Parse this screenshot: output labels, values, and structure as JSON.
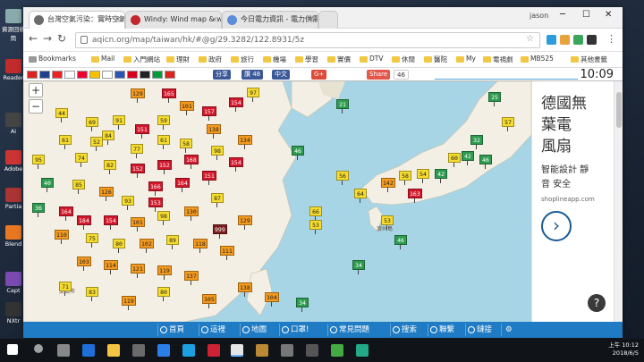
{
  "browser": {
    "tabs": [
      {
        "title": "台灣空氣污染：實時空氣",
        "favicon_color": "#6b6b6b"
      },
      {
        "title": "Windy: Wind map & we",
        "favicon_color": "#c4262e"
      },
      {
        "title": "今日電力資訊 - 電力供需",
        "favicon_color": "#5b8dd9"
      }
    ],
    "user": "jason",
    "address": "aqicn.org/map/taiwan/hk/#@g/29.3282/122.8931/5z",
    "bookmarks": [
      "Bookmarks",
      "Mail",
      "入門網站",
      "理財",
      "政府",
      "旅行",
      "機場",
      "學習",
      "實價",
      "DTV",
      "休閒",
      "醫院",
      "My",
      "電視劇",
      "MB525"
    ],
    "other_bookmarks": "其他書籤"
  },
  "page": {
    "share_label": "分享",
    "like_label": "讚 48",
    "zh_label": "中文",
    "gplus": "G+",
    "share_count_label": "Share",
    "share_count": "46",
    "clock": "10:09",
    "zoom_in": "+",
    "zoom_out": "−"
  },
  "map_markers": [
    {
      "v": "44",
      "c": "y"
    },
    {
      "v": "69",
      "c": "y"
    },
    {
      "v": "61",
      "c": "y"
    },
    {
      "v": "52",
      "c": "y"
    },
    {
      "v": "97",
      "c": "y"
    },
    {
      "v": "95",
      "c": "y"
    },
    {
      "v": "74",
      "c": "y"
    },
    {
      "v": "129",
      "c": "o"
    },
    {
      "v": "165",
      "c": "r"
    },
    {
      "v": "101",
      "c": "o"
    },
    {
      "v": "91",
      "c": "y"
    },
    {
      "v": "151",
      "c": "r"
    },
    {
      "v": "59",
      "c": "y"
    },
    {
      "v": "84",
      "c": "y"
    },
    {
      "v": "157",
      "c": "r"
    },
    {
      "v": "154",
      "c": "r"
    },
    {
      "v": "138",
      "c": "o"
    },
    {
      "v": "77",
      "c": "y"
    },
    {
      "v": "61",
      "c": "y"
    },
    {
      "v": "58",
      "c": "y"
    },
    {
      "v": "82",
      "c": "y"
    },
    {
      "v": "152",
      "c": "r"
    },
    {
      "v": "152",
      "c": "r"
    },
    {
      "v": "168",
      "c": "r"
    },
    {
      "v": "98",
      "c": "y"
    },
    {
      "v": "134",
      "c": "o"
    },
    {
      "v": "154",
      "c": "r"
    },
    {
      "v": "151",
      "c": "r"
    },
    {
      "v": "164",
      "c": "r"
    },
    {
      "v": "166",
      "c": "r"
    },
    {
      "v": "40",
      "c": "g"
    },
    {
      "v": "85",
      "c": "y"
    },
    {
      "v": "126",
      "c": "o"
    },
    {
      "v": "93",
      "c": "y"
    },
    {
      "v": "153",
      "c": "r"
    },
    {
      "v": "36",
      "c": "g"
    },
    {
      "v": "164",
      "c": "r"
    },
    {
      "v": "184",
      "c": "r"
    },
    {
      "v": "154",
      "c": "r"
    },
    {
      "v": "101",
      "c": "o"
    },
    {
      "v": "98",
      "c": "y"
    },
    {
      "v": "130",
      "c": "o"
    },
    {
      "v": "87",
      "c": "y"
    },
    {
      "v": "999",
      "c": "m"
    },
    {
      "v": "129",
      "c": "o"
    },
    {
      "v": "110",
      "c": "o"
    },
    {
      "v": "75",
      "c": "y"
    },
    {
      "v": "80",
      "c": "y"
    },
    {
      "v": "102",
      "c": "o"
    },
    {
      "v": "89",
      "c": "y"
    },
    {
      "v": "118",
      "c": "o"
    },
    {
      "v": "111",
      "c": "o"
    },
    {
      "v": "103",
      "c": "o"
    },
    {
      "v": "114",
      "c": "o"
    },
    {
      "v": "121",
      "c": "o"
    },
    {
      "v": "119",
      "c": "o"
    },
    {
      "v": "137",
      "c": "o"
    },
    {
      "v": "71",
      "c": "y"
    },
    {
      "v": "83",
      "c": "y"
    },
    {
      "v": "46",
      "c": "g"
    },
    {
      "v": "21",
      "c": "g"
    },
    {
      "v": "56",
      "c": "y"
    },
    {
      "v": "64",
      "c": "y"
    },
    {
      "v": "66",
      "c": "y"
    },
    {
      "v": "53",
      "c": "y"
    },
    {
      "v": "58",
      "c": "y"
    },
    {
      "v": "42",
      "c": "g"
    },
    {
      "v": "142",
      "c": "o"
    },
    {
      "v": "163",
      "c": "r"
    },
    {
      "v": "54",
      "c": "y"
    },
    {
      "v": "53",
      "c": "y"
    },
    {
      "v": "46",
      "c": "g"
    },
    {
      "v": "34",
      "c": "g"
    },
    {
      "v": "34",
      "c": "g"
    },
    {
      "v": "42",
      "c": "g"
    },
    {
      "v": "25",
      "c": "g"
    },
    {
      "v": "57",
      "c": "y"
    },
    {
      "v": "32",
      "c": "g"
    },
    {
      "v": "60",
      "c": "y"
    },
    {
      "v": "46",
      "c": "g"
    },
    {
      "v": "80",
      "c": "y"
    },
    {
      "v": "105",
      "c": "o"
    },
    {
      "v": "138",
      "c": "o"
    },
    {
      "v": "104",
      "c": "o"
    },
    {
      "v": "119",
      "c": "o"
    }
  ],
  "ad": {
    "line1": "德國無",
    "line2": "葉電",
    "line3": "風扇",
    "line4": "智能設計 靜",
    "line5": "音 安全",
    "url": "shoplineapp.com",
    "arrow": "›",
    "help": "?"
  },
  "nav": [
    {
      "label": "首頁"
    },
    {
      "label": "這裡"
    },
    {
      "label": "地圖"
    },
    {
      "label": "口罩!"
    },
    {
      "label": "常見問題"
    },
    {
      "label": "搜索"
    },
    {
      "label": "聯繫"
    },
    {
      "label": "鏈接"
    },
    {
      "label": "⚙"
    }
  ],
  "desktop_icons": [
    "資源回收筒",
    "Reader",
    "Ai",
    "Adobe",
    "Partia",
    "Blend",
    "Capt",
    "NXtr"
  ],
  "taskbar": {
    "time": "上午 10:12",
    "date": "2018/6/5"
  },
  "colors": {
    "good": "#2e9b50",
    "moderate": "#f6dc2e",
    "unhealthy_sensitive": "#f49a1f",
    "unhealthy": "#d2182b",
    "hazardous": "#7a1f1f",
    "nav_blue": "#1f7bc3"
  }
}
